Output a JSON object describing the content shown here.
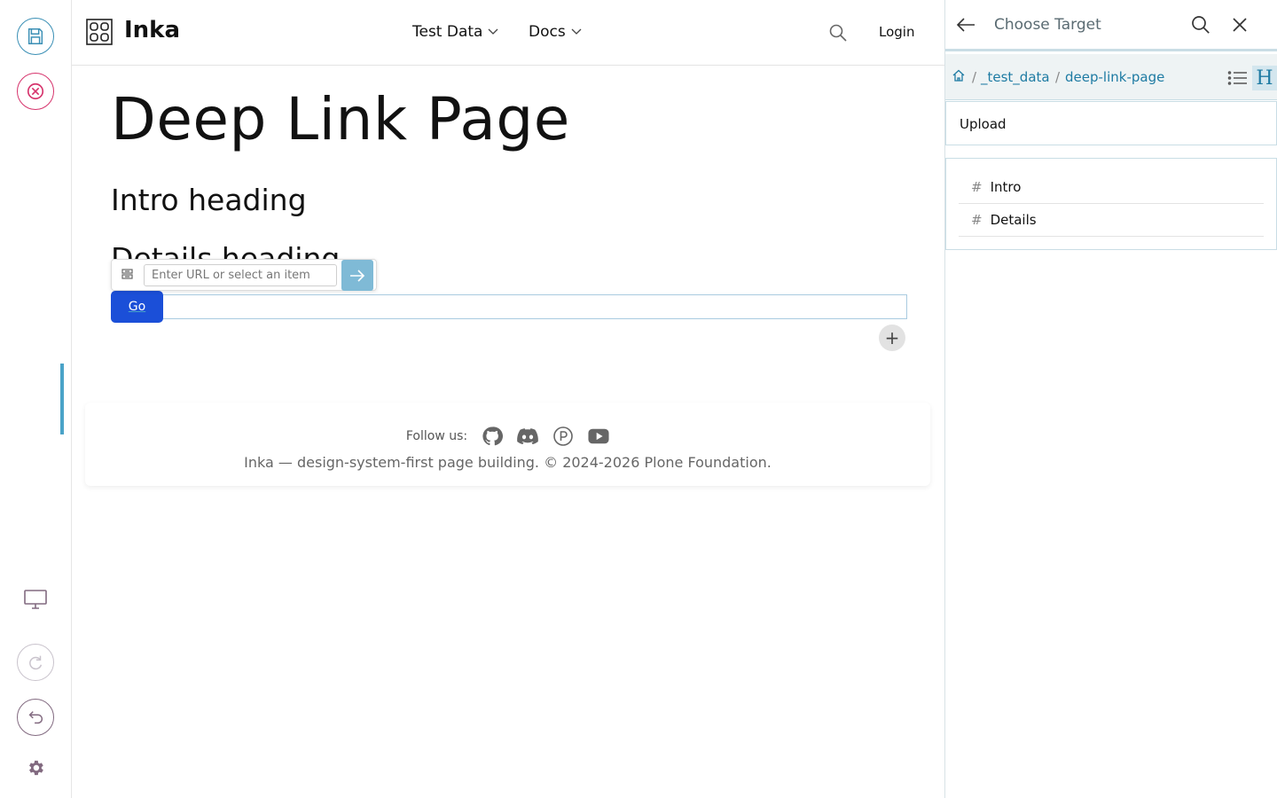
{
  "site": {
    "name": "Inka"
  },
  "nav": {
    "items": [
      {
        "label": "Test Data"
      },
      {
        "label": "Docs"
      }
    ],
    "login": "Login"
  },
  "page": {
    "title": "Deep Link Page",
    "headings": [
      "Intro heading",
      "Details heading"
    ]
  },
  "link_popup": {
    "placeholder": "Enter URL or select an item",
    "value": ""
  },
  "block": {
    "go_label": "Go",
    "add_label": "+"
  },
  "footer": {
    "follow_label": "Follow us:",
    "social": [
      "github-icon",
      "discord-icon",
      "plone-icon",
      "youtube-icon"
    ],
    "copyright": "Inka — design-system-first page building. © 2024-2026 Plone Foundation."
  },
  "panel": {
    "title": "Choose Target",
    "breadcrumb": [
      "_test_data",
      "deep-link-page"
    ],
    "upload_label": "Upload",
    "headings": [
      {
        "label": "Intro"
      },
      {
        "label": "Details"
      }
    ]
  },
  "colors": {
    "accent": "#1e7ba3",
    "go_button": "#1b4fd8",
    "cancel": "#d6336c",
    "save": "#3a8fb5"
  }
}
